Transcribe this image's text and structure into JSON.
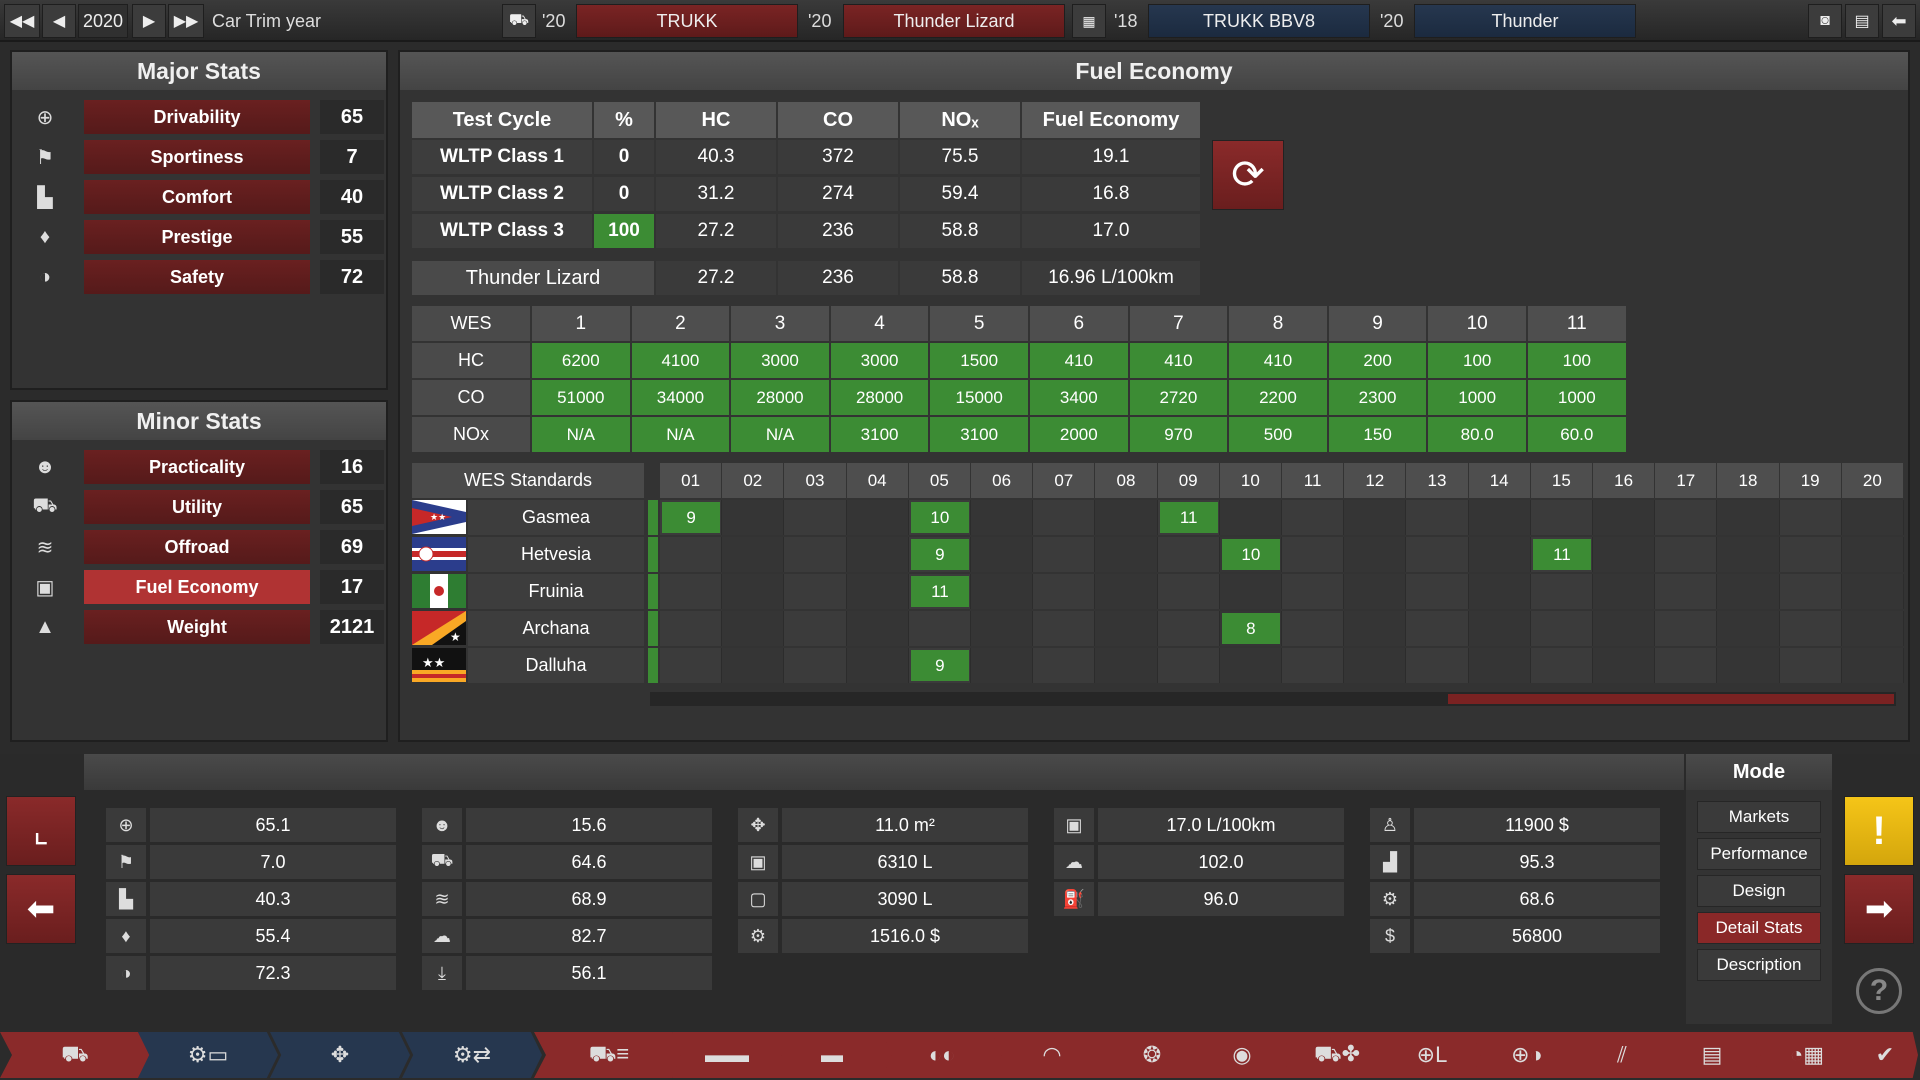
{
  "topbar": {
    "year": "2020",
    "trim_label": "Car Trim year",
    "slots": [
      {
        "year": "'20",
        "name": "TRUKK"
      },
      {
        "year": "'20",
        "name": "Thunder Lizard"
      },
      {
        "year": "'18",
        "name": "TRUKK BBV8"
      },
      {
        "year": "'20",
        "name": "Thunder"
      }
    ]
  },
  "major_stats": {
    "title": "Major Stats",
    "items": [
      {
        "label": "Drivability",
        "value": "65",
        "icon": "steering-wheel-icon"
      },
      {
        "label": "Sportiness",
        "value": "7",
        "icon": "checkered-flag-icon"
      },
      {
        "label": "Comfort",
        "value": "40",
        "icon": "seat-icon"
      },
      {
        "label": "Prestige",
        "value": "55",
        "icon": "diamond-icon"
      },
      {
        "label": "Safety",
        "value": "72",
        "icon": "crash-test-icon"
      }
    ]
  },
  "minor_stats": {
    "title": "Minor Stats",
    "items": [
      {
        "label": "Practicality",
        "value": "16",
        "icon": "people-icon"
      },
      {
        "label": "Utility",
        "value": "65",
        "icon": "truck-icon"
      },
      {
        "label": "Offroad",
        "value": "69",
        "icon": "offroad-icon"
      },
      {
        "label": "Fuel Economy",
        "value": "17",
        "icon": "fuel-can-icon"
      },
      {
        "label": "Weight",
        "value": "2121",
        "icon": "weight-icon"
      }
    ]
  },
  "fuel_economy": {
    "title": "Fuel Economy",
    "headers": [
      "Test Cycle",
      "%",
      "HC",
      "CO",
      "NOₓ",
      "Fuel Economy"
    ],
    "rows": [
      [
        "WLTP Class 1",
        "0",
        "40.3",
        "372",
        "75.5",
        "19.1"
      ],
      [
        "WLTP Class 2",
        "0",
        "31.2",
        "274",
        "59.4",
        "16.8"
      ],
      [
        "WLTP Class 3",
        "100",
        "27.2",
        "236",
        "58.8",
        "17.0"
      ]
    ],
    "summary": [
      "Thunder Lizard",
      "27.2",
      "236",
      "58.8",
      "16.96 L/100km"
    ]
  },
  "wes": {
    "label": "WES",
    "levels": [
      "1",
      "2",
      "3",
      "4",
      "5",
      "6",
      "7",
      "8",
      "9",
      "10",
      "11"
    ],
    "rows": [
      {
        "name": "HC",
        "values": [
          "6200",
          "4100",
          "3000",
          "3000",
          "1500",
          "410",
          "410",
          "410",
          "200",
          "100",
          "100"
        ]
      },
      {
        "name": "CO",
        "values": [
          "51000",
          "34000",
          "28000",
          "28000",
          "15000",
          "3400",
          "2720",
          "2200",
          "2300",
          "1000",
          "1000"
        ]
      },
      {
        "name": "NOx",
        "values": [
          "N/A",
          "N/A",
          "N/A",
          "3100",
          "3100",
          "2000",
          "970",
          "500",
          "150",
          "80.0",
          "60.0"
        ]
      }
    ]
  },
  "wes_standards": {
    "label": "WES Standards",
    "years": [
      "01",
      "02",
      "03",
      "04",
      "05",
      "06",
      "07",
      "08",
      "09",
      "10",
      "11",
      "12",
      "13",
      "14",
      "15",
      "16",
      "17",
      "18",
      "19",
      "20"
    ],
    "countries": [
      {
        "name": "Gasmea",
        "marks": [
          {
            "col": 0,
            "val": "9"
          },
          {
            "col": 4,
            "val": "10"
          },
          {
            "col": 8,
            "val": "11"
          }
        ]
      },
      {
        "name": "Hetvesia",
        "marks": [
          {
            "col": 4,
            "val": "9"
          },
          {
            "col": 9,
            "val": "10"
          },
          {
            "col": 14,
            "val": "11"
          }
        ]
      },
      {
        "name": "Fruinia",
        "marks": [
          {
            "col": 4,
            "val": "11"
          }
        ]
      },
      {
        "name": "Archana",
        "marks": [
          {
            "col": 9,
            "val": "8"
          }
        ]
      },
      {
        "name": "Dalluha",
        "marks": [
          {
            "col": 4,
            "val": "9"
          }
        ]
      }
    ]
  },
  "bottom": {
    "col1": [
      "65.1",
      "7.0",
      "40.3",
      "55.4",
      "72.3"
    ],
    "col2": [
      "15.6",
      "64.6",
      "68.9",
      "82.7",
      "56.1"
    ],
    "col3": [
      "11.0 m²",
      "6310 L",
      "3090 L",
      "1516.0 $"
    ],
    "col4": [
      "17.0 L/100km",
      "102.0",
      "96.0"
    ],
    "col5": [
      "11900 $",
      "95.3",
      "68.6",
      "56800"
    ]
  },
  "mode": {
    "title": "Mode",
    "items": [
      "Markets",
      "Performance",
      "Design",
      "Detail Stats",
      "Description"
    ],
    "active": "Detail Stats"
  }
}
